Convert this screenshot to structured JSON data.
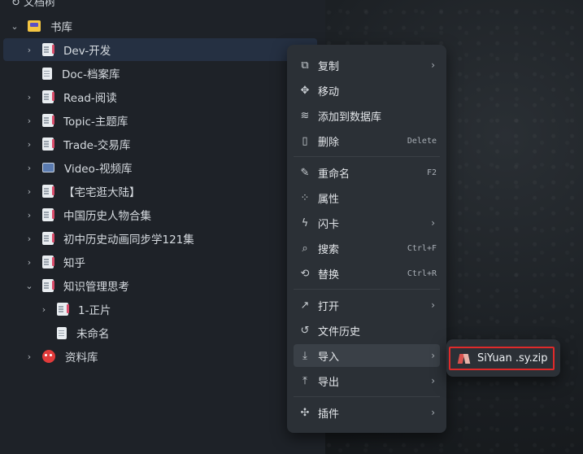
{
  "sidebar": {
    "top_partial": "文档树",
    "notebook": {
      "label": "书库"
    },
    "items": [
      {
        "label": "Dev-开发"
      },
      {
        "label": "Doc-档案库"
      },
      {
        "label": "Read-阅读"
      },
      {
        "label": "Topic-主题库"
      },
      {
        "label": "Trade-交易库"
      },
      {
        "label": "Video-视频库"
      },
      {
        "label": "【宅宅逛大陆】"
      },
      {
        "label": "中国历史人物合集"
      },
      {
        "label": "初中历史动画同步学121集"
      },
      {
        "label": "知乎"
      },
      {
        "label": "知识管理思考"
      },
      {
        "label": "1-正片"
      },
      {
        "label": "未命名"
      },
      {
        "label": "资料库"
      }
    ]
  },
  "menu": {
    "copy": "复制",
    "move": "移动",
    "add_db": "添加到数据库",
    "delete": "删除",
    "delete_sc": "Delete",
    "rename": "重命名",
    "rename_sc": "F2",
    "attr": "属性",
    "flashcard": "闪卡",
    "search": "搜索",
    "search_sc": "Ctrl+F",
    "replace": "替换",
    "replace_sc": "Ctrl+R",
    "open": "打开",
    "history": "文件历史",
    "import": "导入",
    "export": "导出",
    "plugin": "插件"
  },
  "submenu": {
    "siyuan": "SiYuan .sy.zip"
  }
}
